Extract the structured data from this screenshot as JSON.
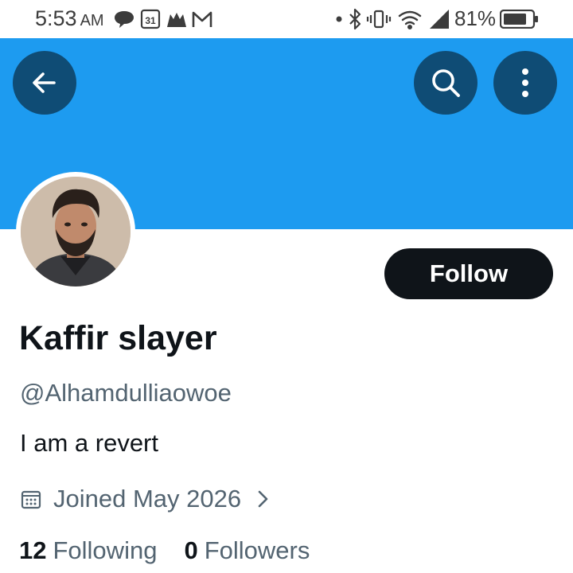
{
  "status_bar": {
    "time": "5:53",
    "ampm": "AM",
    "calendar_day": "31",
    "battery": "81%",
    "left_icons": [
      "chat-bubble-icon",
      "calendar-icon",
      "community-icon",
      "gmail-icon"
    ],
    "right_icons": [
      "dot-icon",
      "bluetooth-icon",
      "vibrate-icon",
      "wifi-icon",
      "signal-icon",
      "battery-icon"
    ]
  },
  "colors": {
    "banner": "#1d9bf0",
    "circle_button": "#0f4c75",
    "follow_button": "#0f1419",
    "secondary_text": "#536471"
  },
  "header": {
    "back_icon": "back-arrow-icon",
    "search_icon": "search-icon",
    "more_icon": "more-vertical-icon"
  },
  "profile": {
    "follow_label": "Follow",
    "display_name": "Kaffir slayer",
    "handle": "@Alhamdulliaowoe",
    "bio": "I am a revert",
    "joined": "Joined May 2026",
    "following_count": "12",
    "following_label": "Following",
    "followers_count": "0",
    "followers_label": "Followers"
  }
}
